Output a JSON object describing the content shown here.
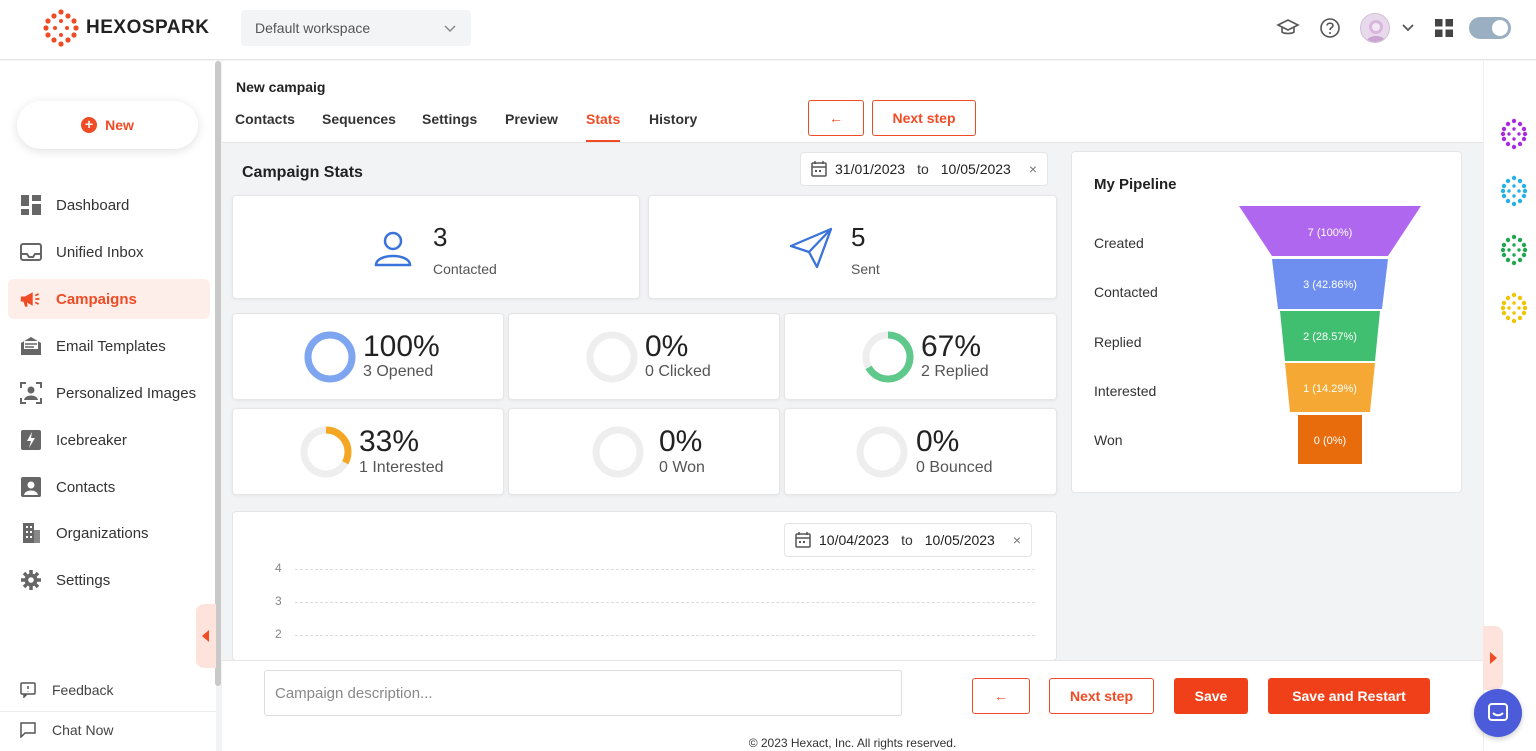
{
  "brand": {
    "name": "HEXOSPARK",
    "accent": "#ef4b25"
  },
  "workspace": {
    "selected": "Default workspace"
  },
  "header_icons": [
    "graduation-cap-icon",
    "help-circle-icon",
    "avatar",
    "chevron-down-icon",
    "apps-grid-icon",
    "toggle"
  ],
  "sidebar": {
    "new_label": "New",
    "items": [
      {
        "label": "Dashboard",
        "icon": "dashboard-icon"
      },
      {
        "label": "Unified Inbox",
        "icon": "inbox-icon"
      },
      {
        "label": "Campaigns",
        "icon": "megaphone-icon",
        "active": true
      },
      {
        "label": "Email Templates",
        "icon": "email-template-icon"
      },
      {
        "label": "Personalized Images",
        "icon": "personalized-image-icon"
      },
      {
        "label": "Icebreaker",
        "icon": "icebreaker-icon"
      },
      {
        "label": "Contacts",
        "icon": "contacts-icon"
      },
      {
        "label": "Organizations",
        "icon": "building-icon"
      },
      {
        "label": "Settings",
        "icon": "gear-icon"
      }
    ],
    "feedback_label": "Feedback",
    "chat_label": "Chat Now"
  },
  "campaign": {
    "title": "New campaig",
    "tabs": [
      "Contacts",
      "Sequences",
      "Settings",
      "Preview",
      "Stats",
      "History"
    ],
    "active_tab": "Stats",
    "back_arrow": "←",
    "next_step_label": "Next step"
  },
  "stats": {
    "section_title": "Campaign Stats",
    "date_from": "31/01/2023",
    "date_to": "10/05/2023",
    "to_label": "to",
    "clear": "×",
    "contacted": {
      "value": "3",
      "label": "Contacted"
    },
    "sent": {
      "value": "5",
      "label": "Sent"
    },
    "rings": [
      {
        "pct": "100%",
        "label": "3 Opened",
        "fraction": 1.0,
        "color": "#7ea6f0"
      },
      {
        "pct": "0%",
        "label": "0 Clicked",
        "fraction": 0,
        "color": "#cccccc"
      },
      {
        "pct": "67%",
        "label": "2 Replied",
        "fraction": 0.67,
        "color": "#5ec98a"
      },
      {
        "pct": "33%",
        "label": "1 Interested",
        "fraction": 0.33,
        "color": "#f5a623"
      },
      {
        "pct": "0%",
        "label": "0 Won",
        "fraction": 0,
        "color": "#cccccc"
      },
      {
        "pct": "0%",
        "label": "0 Bounced",
        "fraction": 0,
        "color": "#cccccc"
      }
    ]
  },
  "pipeline": {
    "title": "My Pipeline",
    "stages": [
      {
        "label": "Created",
        "value": "7 (100%)",
        "color": "#b067ef"
      },
      {
        "label": "Contacted",
        "value": "3 (42.86%)",
        "color": "#6e8ff0"
      },
      {
        "label": "Replied",
        "value": "2 (28.57%)",
        "color": "#3fbf6f"
      },
      {
        "label": "Interested",
        "value": "1 (14.29%)",
        "color": "#f5a833"
      },
      {
        "label": "Won",
        "value": "0 (0%)",
        "color": "#e86c0c"
      }
    ]
  },
  "chart": {
    "date_from": "10/04/2023",
    "date_to": "10/05/2023",
    "to_label": "to",
    "clear": "×",
    "y_ticks": [
      "4",
      "3",
      "2"
    ]
  },
  "chart_data": {
    "type": "funnel",
    "categories": [
      "Created",
      "Contacted",
      "Replied",
      "Interested",
      "Won"
    ],
    "values": [
      7,
      3,
      2,
      1,
      0
    ],
    "labels": [
      "7 (100%)",
      "3 (42.86%)",
      "2 (28.57%)",
      "1 (14.29%)",
      "0 (0%)"
    ],
    "title": "My Pipeline"
  },
  "bottom": {
    "description_placeholder": "Campaign description...",
    "back_arrow": "←",
    "next_step_label": "Next step",
    "save_label": "Save",
    "save_restart_label": "Save and Restart"
  },
  "footer": {
    "copyright": "© 2023 Hexact, Inc. All rights reserved."
  },
  "rail_icons": [
    "purple-hex-app-icon",
    "blue-hex-app-icon",
    "green-hex-app-icon",
    "yellow-hex-app-icon"
  ]
}
